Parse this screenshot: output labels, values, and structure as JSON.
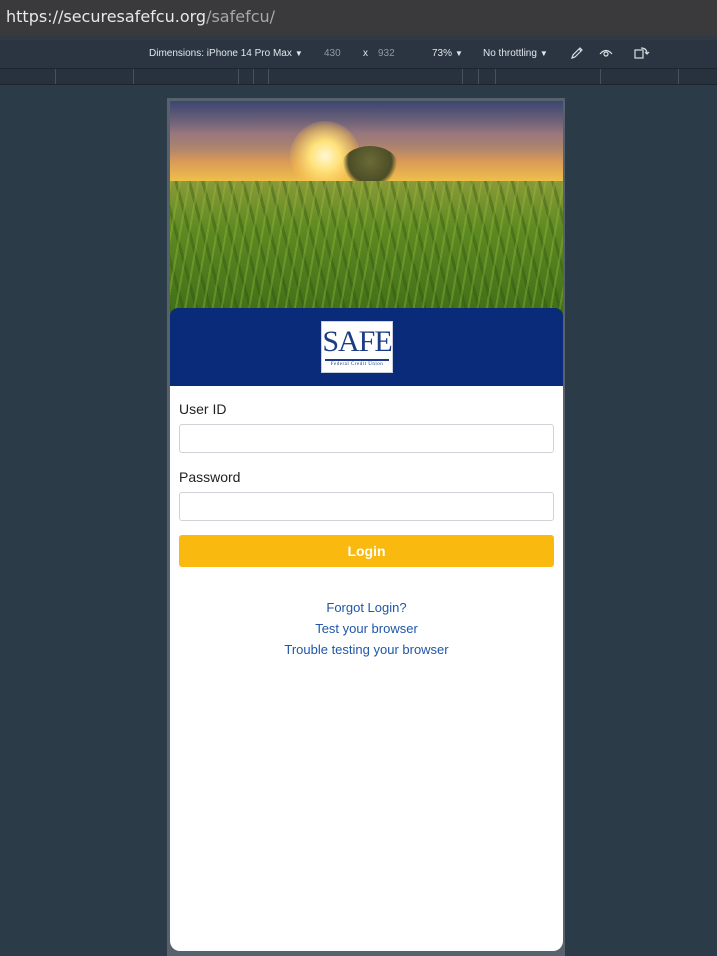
{
  "browser": {
    "url_host": "https://securesafefcu.org",
    "url_path": "/safefcu/"
  },
  "devtools": {
    "dimensions_label": "Dimensions: iPhone 14 Pro Max",
    "width": "430",
    "times": "x",
    "height": "932",
    "zoom": "73%",
    "throttling": "No throttling",
    "icons": [
      "eyedropper-icon",
      "eye-icon",
      "rotate-icon"
    ]
  },
  "brand": {
    "logo_text": "SAFE",
    "logo_subtext": "Federal Credit Union",
    "colors": {
      "header_bg": "#0a2a7a",
      "login_button": "#f9b90e",
      "link": "#1f56a8"
    }
  },
  "form": {
    "user_id_label": "User ID",
    "user_id_value": "",
    "password_label": "Password",
    "password_value": "",
    "login_button": "Login"
  },
  "links": {
    "forgot_login": "Forgot Login?",
    "test_browser": "Test your browser",
    "trouble_testing": "Trouble testing your browser"
  }
}
